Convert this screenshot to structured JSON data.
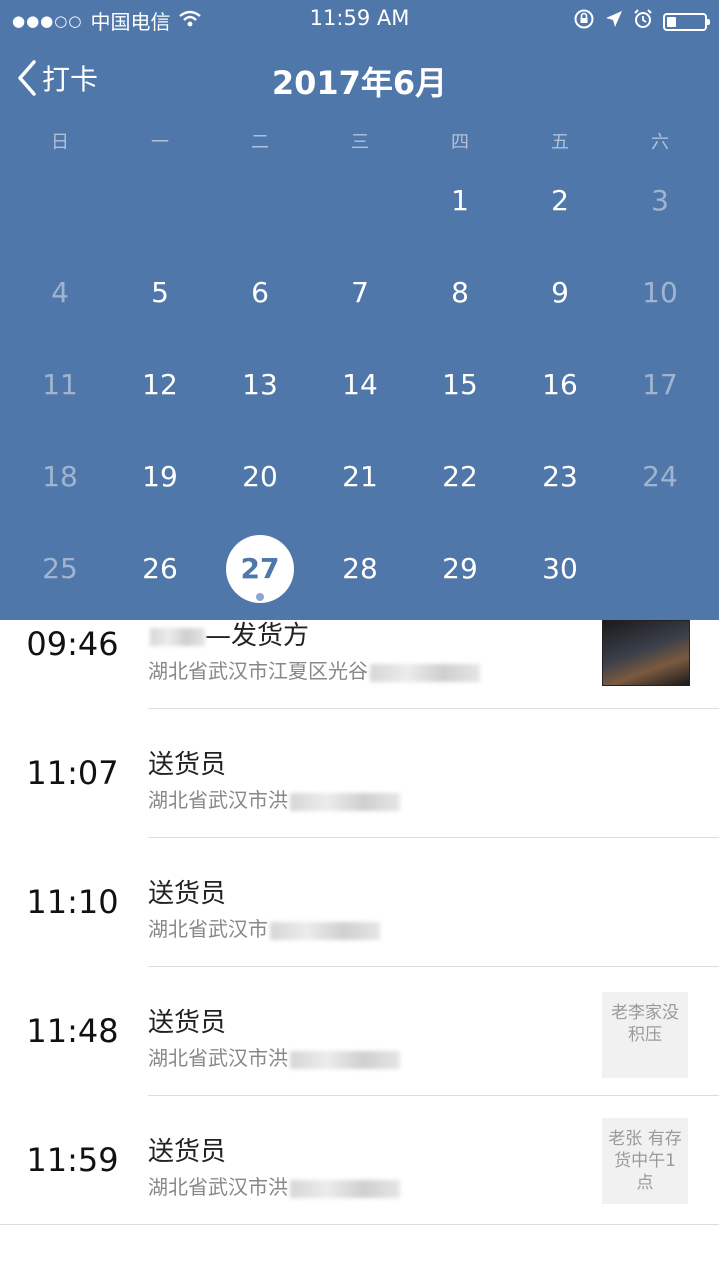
{
  "status_bar": {
    "signal": "●●●○○",
    "carrier": "中国电信",
    "time": "11:59 AM"
  },
  "nav": {
    "back_label": "打卡",
    "title": "2017年6月"
  },
  "calendar": {
    "weekdays": [
      "日",
      "一",
      "二",
      "三",
      "四",
      "五",
      "六"
    ],
    "weeks": [
      [
        "",
        "",
        "",
        "",
        "1",
        "2",
        "3"
      ],
      [
        "4",
        "5",
        "6",
        "7",
        "8",
        "9",
        "10"
      ],
      [
        "11",
        "12",
        "13",
        "14",
        "15",
        "16",
        "17"
      ],
      [
        "18",
        "19",
        "20",
        "21",
        "22",
        "23",
        "24"
      ],
      [
        "25",
        "26",
        "27",
        "28",
        "29",
        "30",
        ""
      ]
    ],
    "selected_day": "27"
  },
  "records": [
    {
      "time": "09:46",
      "name": "—发货方",
      "address": "湖北省武汉市江夏区光谷"
    },
    {
      "time": "11:07",
      "name": "送货员",
      "address": "湖北省武汉市洪"
    },
    {
      "time": "11:10",
      "name": "送货员",
      "address": "湖北省武汉市"
    },
    {
      "time": "11:48",
      "name": "送货员",
      "address": "湖北省武汉市洪",
      "note": "老李家没积压"
    },
    {
      "time": "11:59",
      "name": "送货员",
      "address": "湖北省武汉市洪",
      "note": "老张 有存货中午1点"
    }
  ]
}
